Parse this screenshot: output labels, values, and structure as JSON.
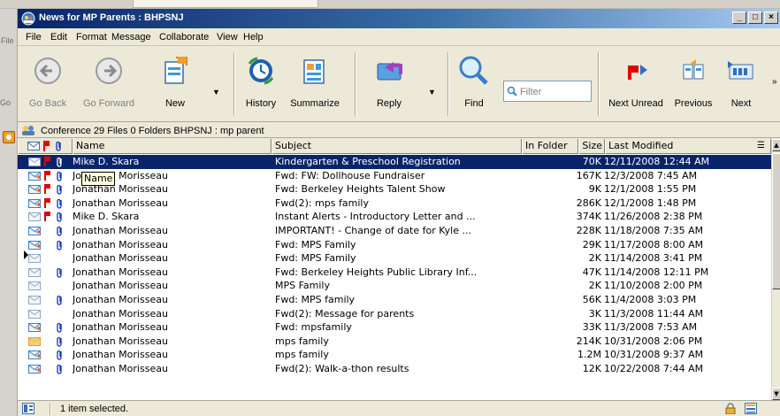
{
  "window": {
    "title": "News for MP Parents : BHPSNJ"
  },
  "gutter": {
    "frag_file": "File",
    "frag_go": "Go"
  },
  "menu": [
    "File",
    "Edit",
    "Format",
    "Message",
    "Collaborate",
    "View",
    "Help"
  ],
  "toolbar": {
    "go_back": "Go Back",
    "go_forward": "Go Forward",
    "new": "New",
    "history": "History",
    "summarize": "Summarize",
    "reply": "Reply",
    "find": "Find",
    "filter_placeholder": "Filter",
    "next_unread": "Next Unread",
    "previous": "Previous",
    "next": "Next"
  },
  "conference": {
    "text": "Conference  29 Files 0 Folders   BHPSNJ : mp parent"
  },
  "columns": {
    "name": "Name",
    "subject": "Subject",
    "in_folder": "In Folder",
    "size": "Size",
    "last_modified": "Last Modified"
  },
  "tooltip": "Name",
  "rows": [
    {
      "name": "Mike D. Skara",
      "subject": "Kindergarten & Preschool Registration",
      "size": "70K",
      "modified": "12/11/2008  12:44 AM",
      "icon": "read",
      "flag": true,
      "attach": true,
      "selected": true
    },
    {
      "name": "Jonathan Morisseau",
      "subject": "Fwd: FW: Dollhouse Fundraiser",
      "size": "167K",
      "modified": "12/3/2008   7:45 AM",
      "icon": "forwarded",
      "flag": true,
      "attach": true
    },
    {
      "name": "Jonathan Morisseau",
      "subject": "Fwd: Berkeley Heights Talent Show",
      "size": "9K",
      "modified": "12/1/2008   1:55 PM",
      "icon": "forwarded",
      "flag": true,
      "attach": true
    },
    {
      "name": "Jonathan Morisseau",
      "subject": "Fwd(2): mps family",
      "size": "286K",
      "modified": "12/1/2008   1:48 PM",
      "icon": "forwarded",
      "flag": true,
      "attach": true
    },
    {
      "name": "Mike D. Skara",
      "subject": " Instant Alerts - Introductory Letter and ...",
      "size": "374K",
      "modified": "11/26/2008  2:38 PM",
      "icon": "read",
      "flag": true,
      "attach": true
    },
    {
      "name": "Jonathan Morisseau",
      "subject": " IMPORTANT! - Change of date for Kyle ...",
      "size": "228K",
      "modified": "11/18/2008  7:35 AM",
      "icon": "forwarded",
      "flag": false,
      "attach": true
    },
    {
      "name": "Jonathan Morisseau",
      "subject": "Fwd: MPS Family",
      "size": "29K",
      "modified": "11/17/2008  8:00 AM",
      "icon": "forwarded",
      "flag": false,
      "attach": true
    },
    {
      "name": "Jonathan Morisseau",
      "subject": "Fwd: MPS Family",
      "size": "2K",
      "modified": "11/14/2008  3:41 PM",
      "icon": "read",
      "flag": false,
      "attach": false
    },
    {
      "name": "Jonathan Morisseau",
      "subject": "Fwd: Berkeley Heights Public Library Inf...",
      "size": "47K",
      "modified": "11/14/2008  12:11 PM",
      "icon": "read",
      "flag": false,
      "attach": true
    },
    {
      "name": "Jonathan Morisseau",
      "subject": "MPS Family",
      "size": "2K",
      "modified": "11/10/2008  2:00 PM",
      "icon": "read",
      "flag": false,
      "attach": false
    },
    {
      "name": "Jonathan Morisseau",
      "subject": "Fwd: MPS family",
      "size": "56K",
      "modified": "11/4/2008   3:03 PM",
      "icon": "read",
      "flag": false,
      "attach": true
    },
    {
      "name": "Jonathan Morisseau",
      "subject": "Fwd(2): Message for parents",
      "size": "3K",
      "modified": "11/3/2008   11:44 AM",
      "icon": "read",
      "flag": false,
      "attach": false
    },
    {
      "name": "Jonathan Morisseau",
      "subject": "Fwd: mpsfamily",
      "size": "33K",
      "modified": "11/3/2008   7:53 AM",
      "icon": "forwarded",
      "flag": false,
      "attach": true
    },
    {
      "name": "Jonathan Morisseau",
      "subject": "mps family",
      "size": "214K",
      "modified": "10/31/2008  2:06 PM",
      "icon": "replied",
      "flag": false,
      "attach": true
    },
    {
      "name": "Jonathan Morisseau",
      "subject": "mps family",
      "size": "1.2M",
      "modified": "10/31/2008  9:37 AM",
      "icon": "forwarded",
      "flag": false,
      "attach": true
    },
    {
      "name": "Jonathan Morisseau",
      "subject": "Fwd(2):  Walk-a-thon results",
      "size": "12K",
      "modified": "10/22/2008  7:44 AM",
      "icon": "forwarded",
      "flag": false,
      "attach": true
    }
  ],
  "status": {
    "text": "1 item selected."
  },
  "colors": {
    "title_start": "#0a246a",
    "title_end": "#a6caf0",
    "selection": "#0a246a",
    "flag": "#e00000",
    "clip": "#1030c0"
  }
}
